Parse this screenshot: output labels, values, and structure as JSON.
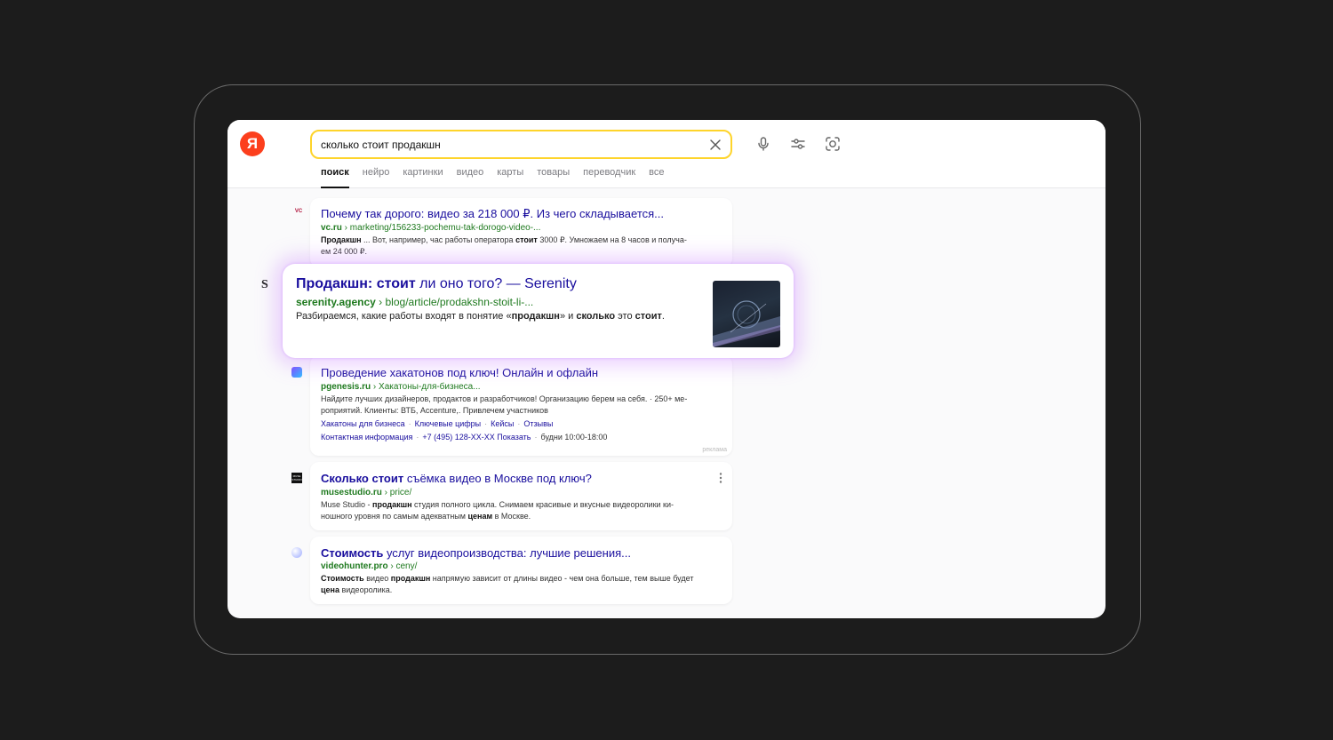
{
  "header": {
    "logo": "Я",
    "search_value": "сколько стоит продакшн",
    "tabs": [
      "поиск",
      "нейро",
      "картинки",
      "видео",
      "карты",
      "товары",
      "переводчик",
      "все"
    ],
    "icons": [
      "microphone-icon",
      "filter-icon",
      "camera-search-icon"
    ]
  },
  "results": [
    {
      "favicon": "VC",
      "title": "Почему так дорого: видео за 218 000 ₽. Из чего складывается...",
      "url_domain": "vc.ru",
      "url_path": "marketing/156233-pochemu-tak-dorogo-video-...",
      "snippet_line1": "... Вот, например, час работы оператора",
      "snippet_b1": "Продакшн",
      "snippet_b2": "стоит",
      "snippet_line1_tail": "3000 ₽. Умножаем на 8 часов и получа-",
      "snippet_line2": "ем 24 000 ₽."
    },
    {
      "favicon": "S",
      "title_b1": "Продакшн",
      "title_b2": "стоит",
      "title_tail": "ли оно того? — Serenity",
      "url_domain": "serenity.agency",
      "url_path": "blog/article/prodakshn-stoit-li-...",
      "snippet_head": "Разбираемся, какие работы входят в понятие «",
      "snippet_b1": "продакшн",
      "snippet_mid": "» и",
      "snippet_b2": "сколько",
      "snippet_mid2": "это",
      "snippet_b3": "стоит",
      "snippet_end": "."
    },
    {
      "title": "Проведение хакатонов под ключ! Онлайн и офлайн",
      "url_domain": "pgenesis.ru",
      "url_path": "Хакатоны-для-бизнеса...",
      "snippet_line1": "Найдите лучших дизайнеров, продактов и разработчиков! Организацию берем на себя. · 250+ ме-",
      "snippet_line2": "роприятий. Клиенты: ВТБ, Accenture,. Привлечем участников",
      "sitelinks": [
        "Хакатоны для бизнеса",
        "Ключевые цифры",
        "Кейсы",
        "Отзывы"
      ],
      "contact_label": "Контактная информация",
      "phone": "+7 (495) 128-XX-XX Показать",
      "hours": "будни 10:00-18:00",
      "ad_label": "реклама"
    },
    {
      "favicon": "MUSE STUDIO",
      "title_b1": "Сколько стоит",
      "title_tail": "съёмка видео в Москве под ключ?",
      "url_domain": "musestudio.ru",
      "url_path": "price/",
      "snippet_head": "Muse Studio -",
      "snippet_b1": "продакшн",
      "snippet_line1_tail": "студия полного цикла. Снимаем красивые и вкусные видеоролики ки-",
      "snippet_line2_head": "ношного уровня по самым адекватным",
      "snippet_b2": "ценам",
      "snippet_line2_tail": "в Москве."
    },
    {
      "title_b1": "Стоимость",
      "title_tail": "услуг видеопроизводства: лучшие решения...",
      "url_domain": "videohunter.pro",
      "url_path": "ceny/",
      "snippet_b1": "Стоимость",
      "snippet_mid": "видео",
      "snippet_b2": "продакшн",
      "snippet_line1_tail": "напрямую зависит от длины видео - чем она больше, тем выше будет",
      "snippet_b3": "цена",
      "snippet_line2_tail": "видеоролика."
    }
  ],
  "colors": {
    "logo": "#fc3f1d",
    "search_border": "#fed42b",
    "link": "#1a0f9e",
    "url": "#1f7a1f",
    "glow": "#c678ff"
  }
}
